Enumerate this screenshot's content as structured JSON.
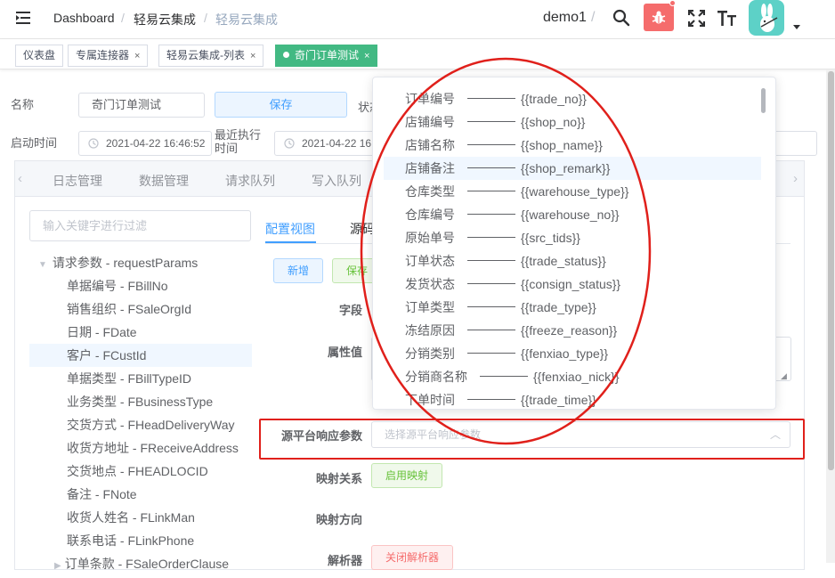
{
  "header": {
    "breadcrumb": [
      "Dashboard",
      "轻易云集成",
      "轻易云集成"
    ],
    "separator": "/",
    "user": "demo1",
    "user_sep": "/"
  },
  "tags": [
    {
      "label": "仪表盘",
      "close": ""
    },
    {
      "label": "专属连接器",
      "close": "×"
    },
    {
      "label": "轻易云集成-列表",
      "close": "×"
    },
    {
      "label": "奇门订单测试",
      "close": "×"
    }
  ],
  "form": {
    "name_label": "名称",
    "name_value": "奇门订单测试",
    "save_label": "保存",
    "status_label": "状态",
    "start_label": "启动时间",
    "start_value": "2021-04-22 16:46:52",
    "last_exec_label": "最近执行时间",
    "last_exec_value": "2021-04-22 16:"
  },
  "panel_tabs": [
    "日志管理",
    "数据管理",
    "请求队列",
    "写入队列"
  ],
  "filter_placeholder": "输入关键字进行过滤",
  "tree": {
    "root": "请求参数 - requestParams",
    "items": [
      "单据编号 - FBillNo",
      "销售组织 - FSaleOrgId",
      "日期 - FDate",
      "客户 - FCustId",
      "单据类型 - FBillTypeID",
      "业务类型 - FBusinessType",
      "交货方式 - FHeadDeliveryWay",
      "收货方地址 - FReceiveAddress",
      "交货地点 - FHEADLOCID",
      "备注 - FNote",
      "收货人姓名 - FLinkMan",
      "联系电话 - FLinkPhone",
      "订单条款 - FSaleOrderClause"
    ],
    "selected_index": 3
  },
  "config": {
    "view_tab": "配置视图",
    "source_tab": "源码",
    "add_label": "新增",
    "save_label": "保存",
    "field_label": "字段",
    "attr_label": "属性值",
    "response_label": "源平台响应参数",
    "response_placeholder": "选择源平台响应参数",
    "mapping_label": "映射关系",
    "mapping_btn": "启用映射",
    "direction_label": "映射方向",
    "parser_label": "解析器",
    "parser_btn": "关闭解析器"
  },
  "options": [
    {
      "name": "订单编号",
      "var": "{{trade_no}}"
    },
    {
      "name": "店铺编号",
      "var": "{{shop_no}}"
    },
    {
      "name": "店铺名称",
      "var": "{{shop_name}}"
    },
    {
      "name": "店铺备注",
      "var": "{{shop_remark}}"
    },
    {
      "name": "仓库类型",
      "var": "{{warehouse_type}}"
    },
    {
      "name": "仓库编号",
      "var": "{{warehouse_no}}"
    },
    {
      "name": "原始单号",
      "var": "{{src_tids}}"
    },
    {
      "name": "订单状态",
      "var": "{{trade_status}}"
    },
    {
      "name": "发货状态",
      "var": "{{consign_status}}"
    },
    {
      "name": "订单类型",
      "var": "{{trade_type}}"
    },
    {
      "name": "冻结原因",
      "var": "{{freeze_reason}}"
    },
    {
      "name": "分销类别",
      "var": "{{fenxiao_type}}"
    },
    {
      "name": "分销商名称",
      "var": "{{fenxiao_nick}}"
    },
    {
      "name": "下单时间",
      "var": "{{trade_time}}"
    }
  ],
  "highlighted_option": 3,
  "colors": {
    "accent": "#409eff",
    "active_tag": "#42b983",
    "danger": "#f56c6c",
    "success": "#67c23a",
    "annotation": "#e0201b"
  },
  "icons": [
    "menu-fold-icon",
    "search-icon",
    "bug-icon",
    "fullscreen-icon",
    "font-size-icon",
    "avatar",
    "caret-down-icon"
  ]
}
